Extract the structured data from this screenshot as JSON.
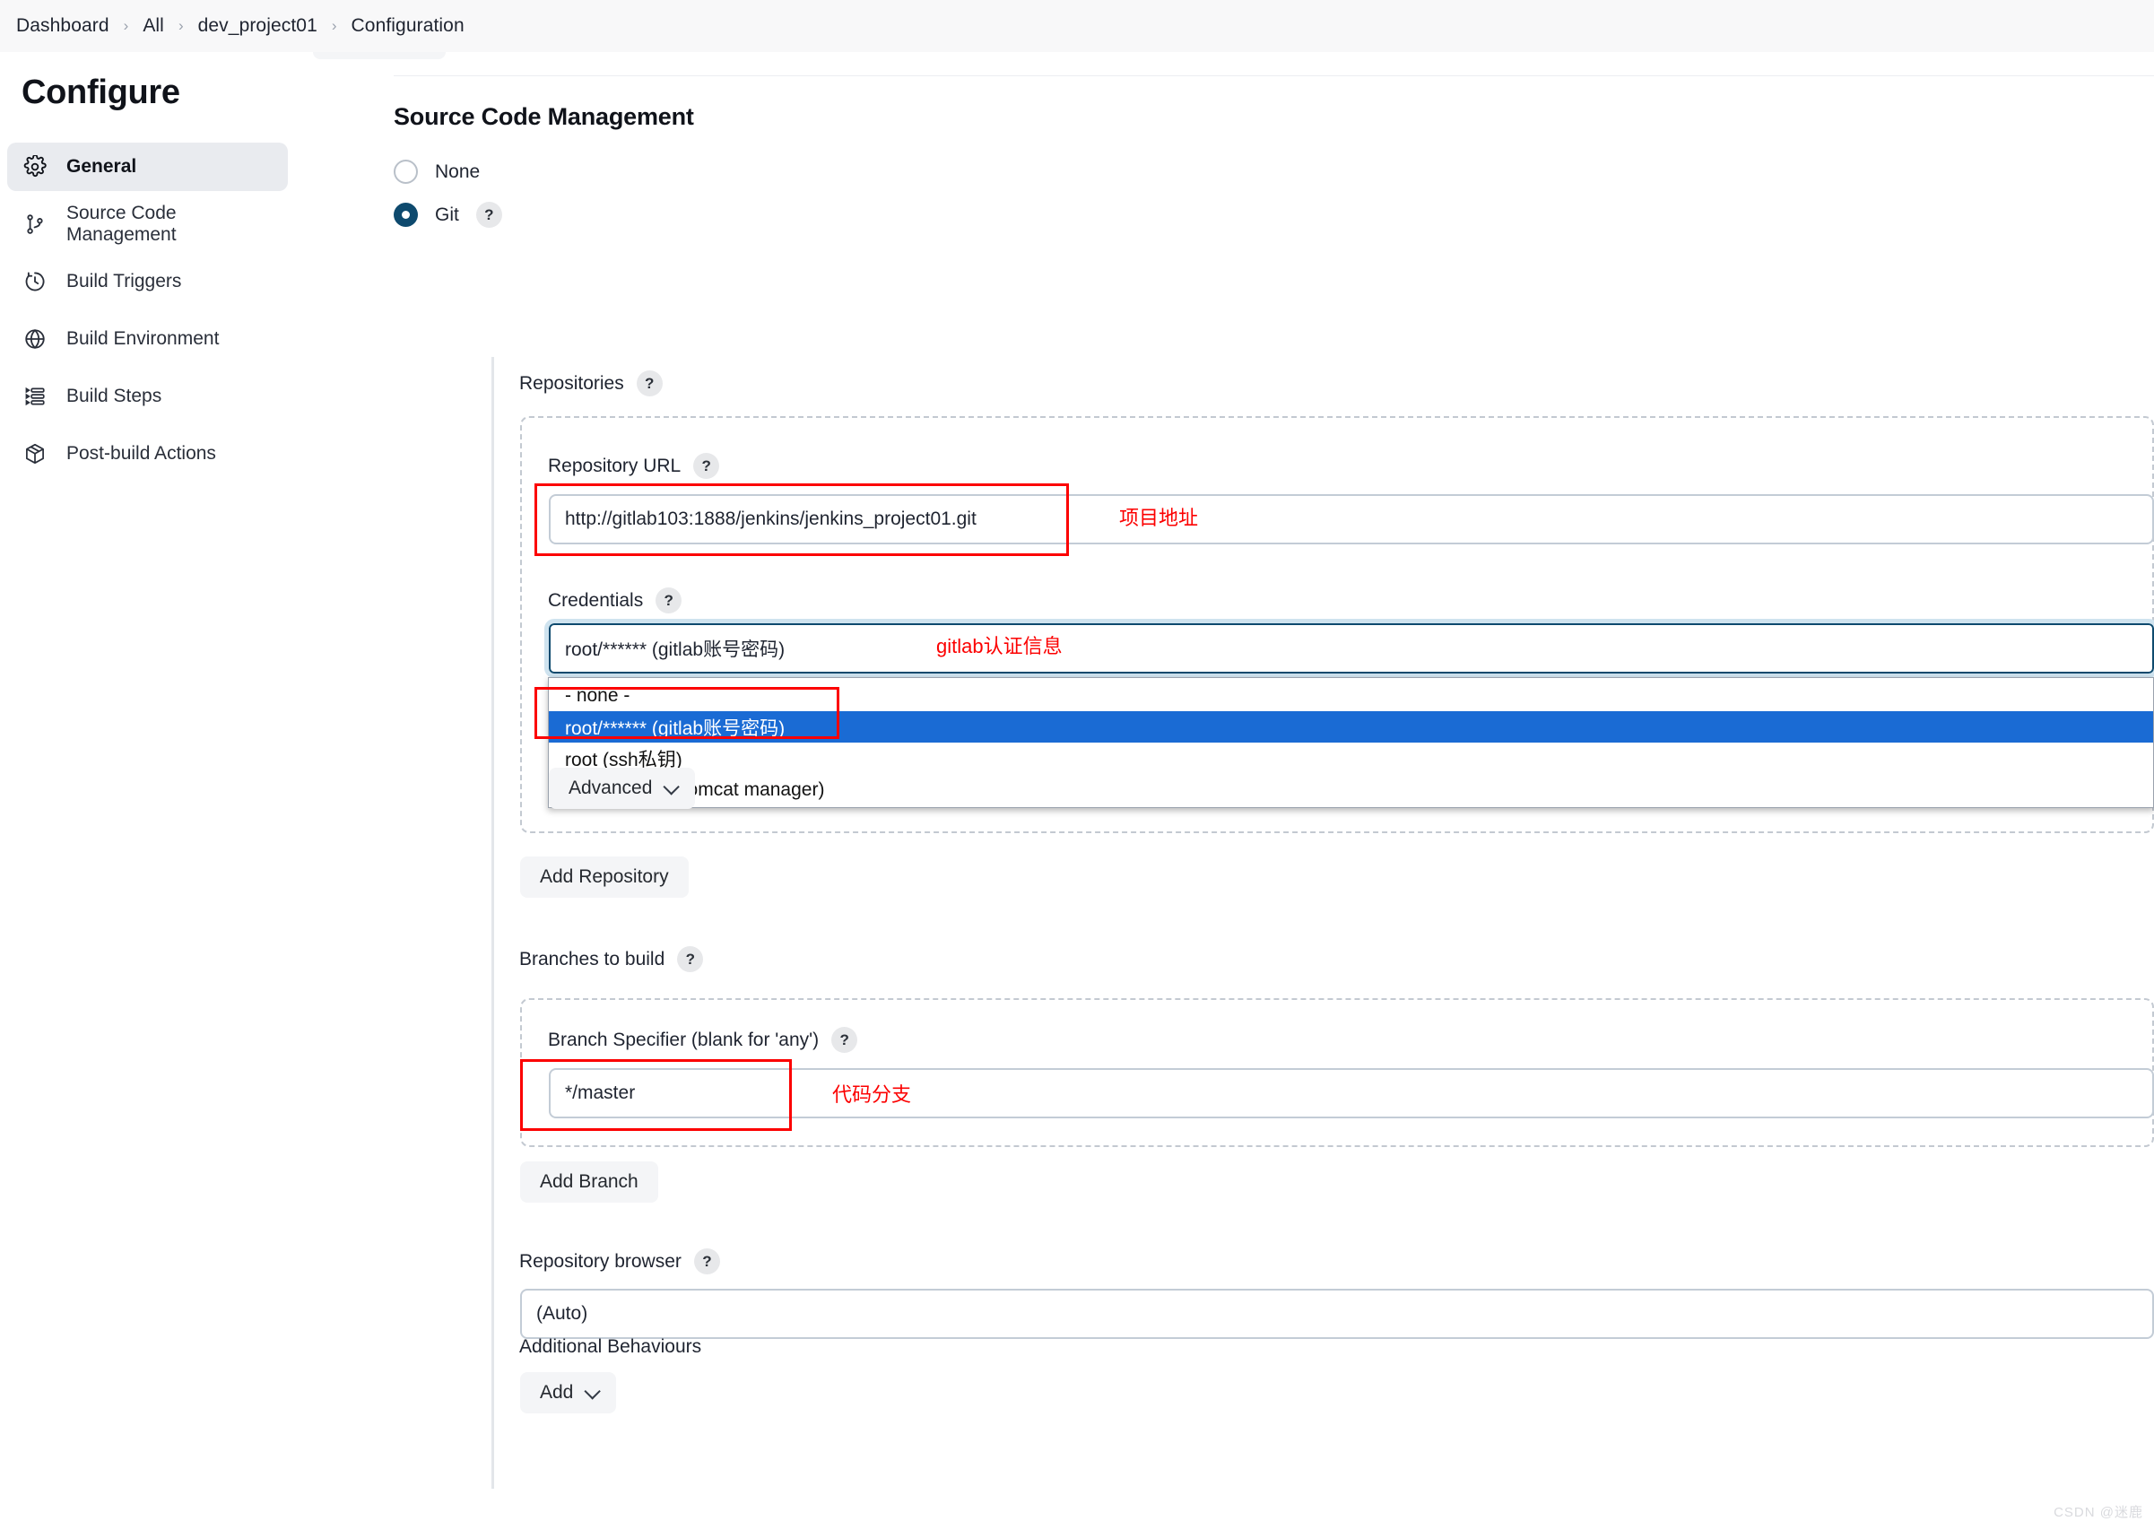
{
  "breadcrumb": {
    "items": [
      "Dashboard",
      "All",
      "dev_project01",
      "Configuration"
    ],
    "separator": "›"
  },
  "top_toolbar": {
    "advanced_label": "Advanced"
  },
  "sidebar": {
    "title": "Configure",
    "items": [
      {
        "label": "General",
        "icon": "gear-icon",
        "active": true
      },
      {
        "label": "Source Code Management",
        "icon": "git-branch-icon",
        "active": false
      },
      {
        "label": "Build Triggers",
        "icon": "clock-icon",
        "active": false
      },
      {
        "label": "Build Environment",
        "icon": "globe-icon",
        "active": false
      },
      {
        "label": "Build Steps",
        "icon": "list-icon",
        "active": false
      },
      {
        "label": "Post-build Actions",
        "icon": "package-icon",
        "active": false
      }
    ]
  },
  "main": {
    "section_title": "Source Code Management",
    "scm_options": [
      {
        "label": "None",
        "selected": false
      },
      {
        "label": "Git",
        "selected": true,
        "has_help": true
      }
    ],
    "repositories": {
      "label": "Repositories",
      "repository_url": {
        "label": "Repository URL",
        "value": "http://gitlab103:1888/jenkins/jenkins_project01.git",
        "annotation": "项目地址"
      },
      "credentials": {
        "label": "Credentials",
        "value": "root/****** (gitlab账号密码)",
        "annotation": "gitlab认证信息",
        "options": [
          {
            "label": "- none -",
            "selected": false
          },
          {
            "label": "root/****** (gitlab账号密码)",
            "selected": true
          },
          {
            "label": "root (ssh私钥)",
            "selected": false
          },
          {
            "label": "tomcat/****** (tomcat manager)",
            "selected": false
          }
        ]
      },
      "advanced_label": "Advanced",
      "add_repository_label": "Add Repository"
    },
    "branches": {
      "label": "Branches to build",
      "specifier_label": "Branch Specifier (blank for 'any')",
      "specifier_value": "*/master",
      "annotation": "代码分支",
      "add_branch_label": "Add Branch"
    },
    "repository_browser": {
      "label": "Repository browser",
      "value": "(Auto)"
    },
    "additional_behaviours": {
      "label": "Additional Behaviours",
      "add_label": "Add"
    }
  },
  "watermark": "CSDN @迷鹿",
  "colors": {
    "accent_dark": "#0e4a6e",
    "highlight_blue": "#1a6bd4",
    "annotation_red": "#fc0000",
    "sidebar_active": "#e9ebef"
  }
}
